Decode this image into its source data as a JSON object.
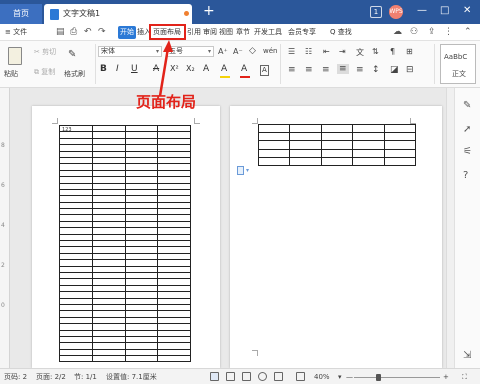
{
  "titlebar": {
    "home_tab": "首页",
    "doc_tab": "文字文稿1",
    "new_tab": "+",
    "window_number": "1",
    "avatar_text": "WPS",
    "minimize": "—",
    "maximize": "□",
    "close": "✕"
  },
  "menubar": {
    "file_menu": "≡ 文件",
    "tabs": [
      "开始",
      "插入",
      "页面布局",
      "引用",
      "审阅",
      "视图",
      "章节",
      "开发工具",
      "会员专享"
    ],
    "search": "Q 查找"
  },
  "ribbon": {
    "paste_label": "粘贴",
    "cut": "剪切",
    "copy": "复制",
    "format_painter": "格式刷",
    "font_name": "宋体",
    "font_size": "五号",
    "grow_font": "A⁺",
    "shrink_font": "A⁻",
    "clear_format": "◇",
    "pinyin": "wén",
    "bold": "B",
    "italic": "I",
    "underline": "U",
    "strike": "A",
    "superscript": "X²",
    "subscript": "X₂",
    "text_effect": "A",
    "highlight": "A",
    "font_color": "A",
    "char_border": "A",
    "style_preview": "AaBbC",
    "style_name": "正文",
    "colors": {
      "highlight": "#f5d30a",
      "font": "#e2231a",
      "underline_bar": "#333333"
    }
  },
  "document": {
    "cell_text": "123"
  },
  "annotation": {
    "label": "页面布局",
    "color": "#e2231a"
  },
  "statusbar": {
    "page_num": "页码: 2",
    "page_count": "页面: 2/2",
    "section": "节: 1/1",
    "settings": "设置值: 7.1厘米",
    "zoom": "40%",
    "zoom_minus": "—",
    "zoom_plus": "+",
    "zoom_level": 0.25
  }
}
